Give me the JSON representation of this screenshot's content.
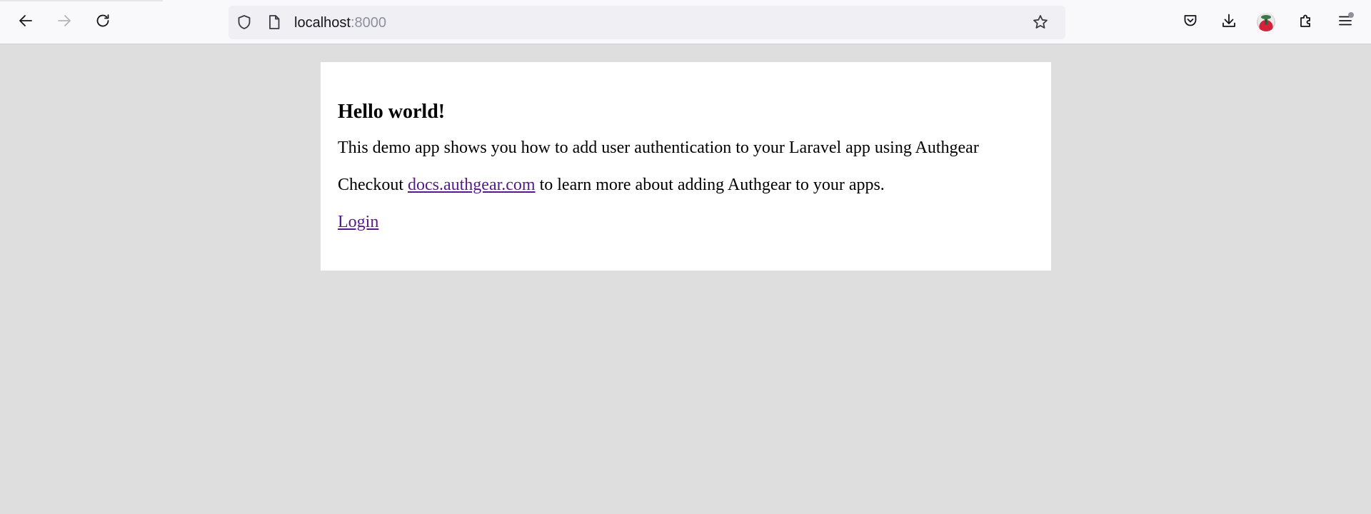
{
  "browser": {
    "url_host": "localhost",
    "url_port": ":8000",
    "icons": {
      "back": "arrow-left-icon",
      "forward": "arrow-right-icon",
      "reload": "reload-icon",
      "tracking_protection": "shield-icon",
      "page_info": "page-icon",
      "bookmark": "star-icon",
      "pocket": "pocket-icon",
      "downloads": "download-icon",
      "account": "avatar",
      "extensions": "puzzle-icon",
      "menu": "hamburger-menu-icon"
    },
    "forward_disabled": true
  },
  "page": {
    "heading": "Hello world!",
    "description": "This demo app shows you how to add user authentication to your Laravel app using Authgear",
    "checkout_prefix": "Checkout ",
    "docs_link": "docs.authgear.com",
    "checkout_suffix": " to learn more about adding Authgear to your apps.",
    "login_link": "Login",
    "link_color": "#551a8b"
  }
}
